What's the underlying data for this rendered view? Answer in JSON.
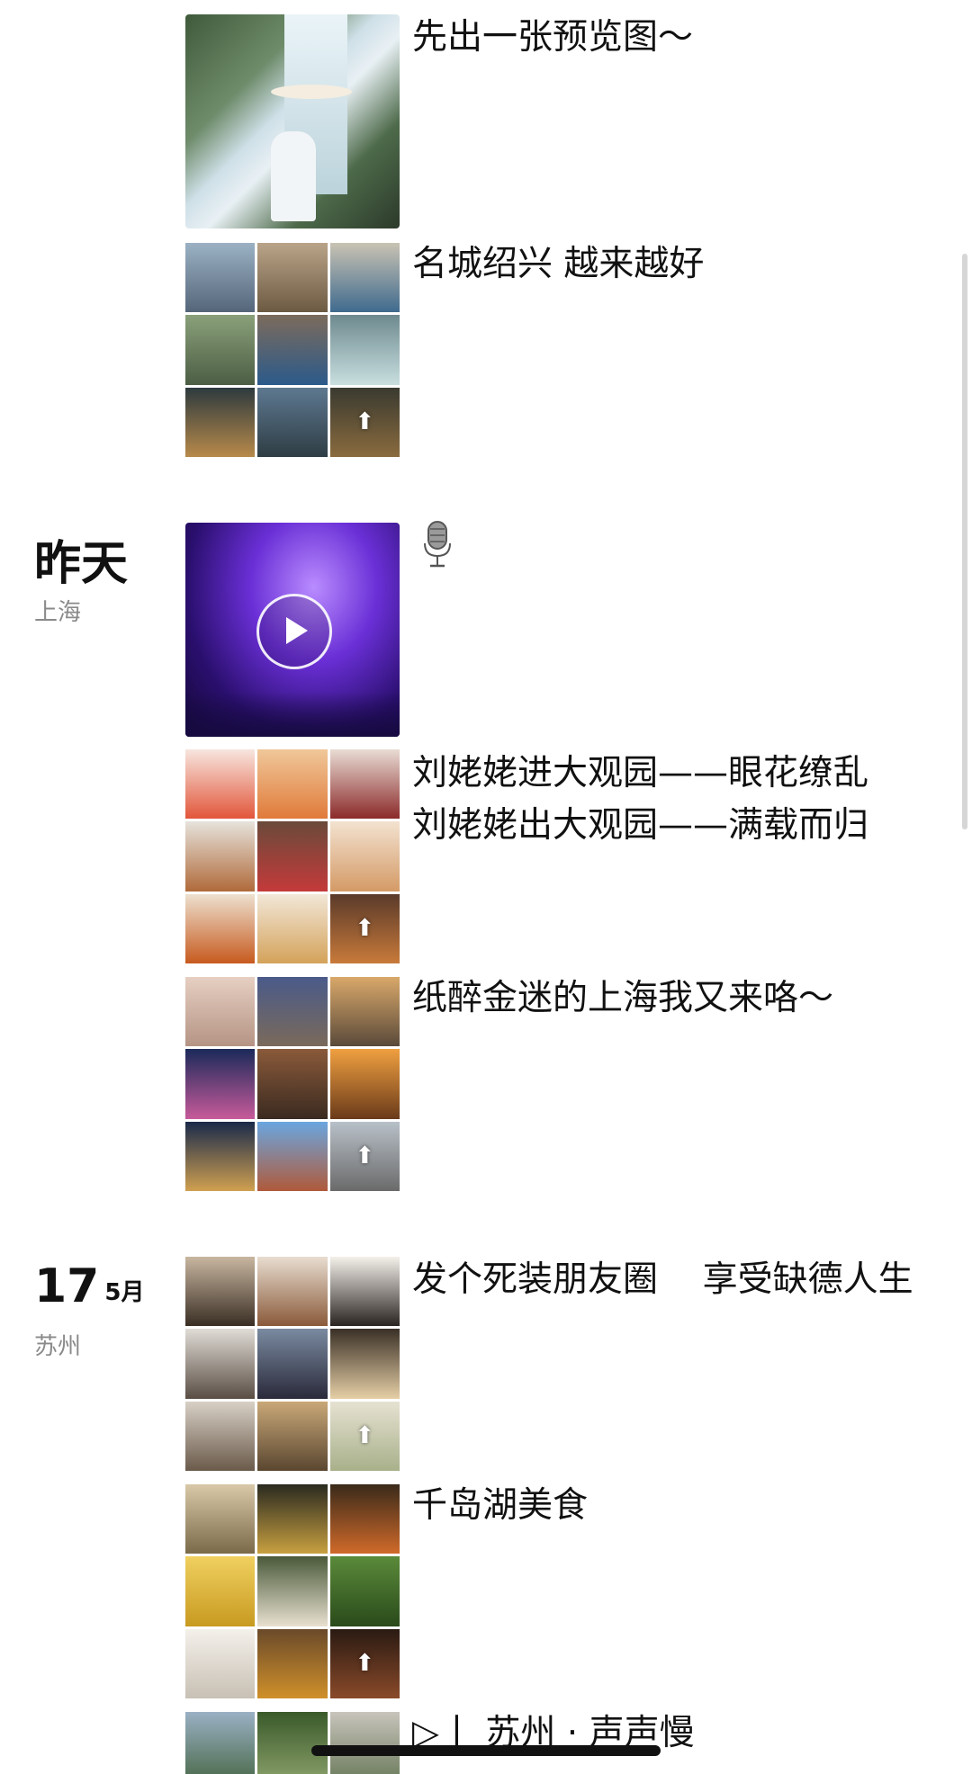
{
  "posts": [
    {
      "caption": "先出一张预览图～"
    },
    {
      "caption": "名城绍兴 越来越好"
    },
    {
      "caption_icon": "microphone-emoji",
      "media": "video"
    },
    {
      "caption": "刘姥姥进大观园——眼花缭乱\n刘姥姥出大观园——满载而归"
    },
    {
      "caption": "纸醉金迷的上海我又来咯～"
    },
    {
      "caption": "发个死装朋友圈    享受缺德人生"
    },
    {
      "caption": "千岛湖美食"
    },
    {
      "caption": "▷丨 苏州 · 声声慢"
    }
  ],
  "dates": {
    "yesterday": {
      "label": "昨天",
      "location": "上海"
    },
    "may17": {
      "day": "17",
      "month": "5月",
      "location": "苏州"
    }
  },
  "colors": {
    "background": "#ffffff",
    "text": "#111111",
    "secondary": "#8a8a8a"
  }
}
